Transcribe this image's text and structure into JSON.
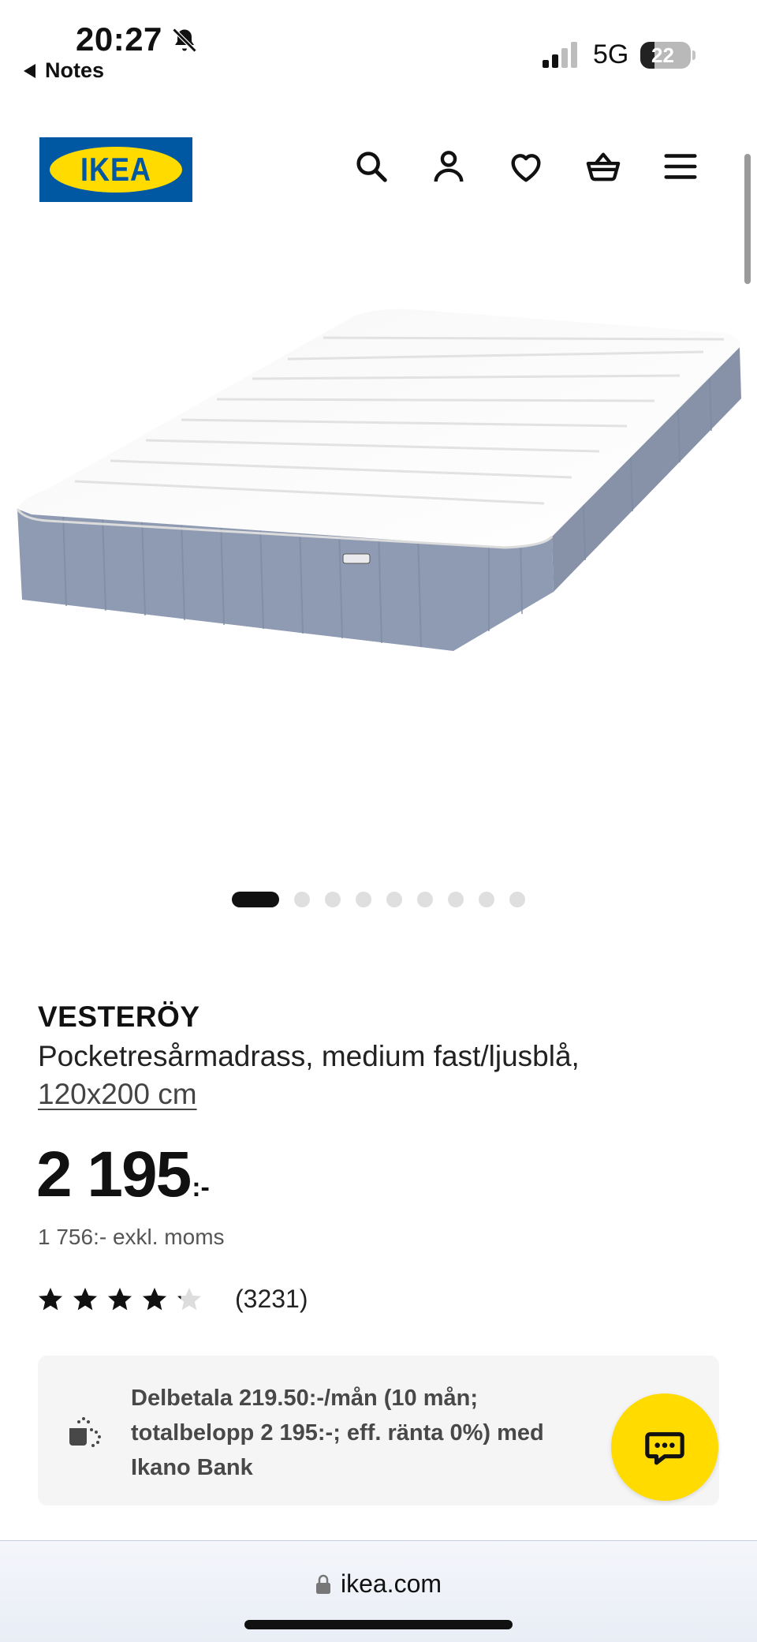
{
  "status_bar": {
    "time": "20:27",
    "back_label": "Notes",
    "network": "5G",
    "battery": "22",
    "icons": [
      "bell-slash-icon",
      "signal-icon",
      "battery-icon"
    ]
  },
  "header": {
    "logo_text": "IKEA",
    "icons": [
      "search-icon",
      "account-icon",
      "heart-icon",
      "basket-icon",
      "menu-icon"
    ]
  },
  "carousel": {
    "total": 9,
    "active_index": 0
  },
  "product": {
    "name": "VESTERÖY",
    "description": "Pocketresårmadrass, medium fast/ljusblå,",
    "size": "120x200 cm",
    "price_amount": "2 195",
    "price_suffix": ":-",
    "price_ex_vat": "1 756:- exkl. moms",
    "rating": 4,
    "rating_max": 5,
    "review_count": "(3231)"
  },
  "finance": {
    "text": "Delbetala 219.50:-/mån (10 mån; totalbelopp 2 195:-; eff. ränta 0%) med Ikano Bank"
  },
  "url_bar": {
    "domain": "ikea.com"
  },
  "colors": {
    "ikea_blue": "#0058a3",
    "ikea_yellow": "#ffdb00",
    "mattress_side": "#8f9bb3"
  }
}
